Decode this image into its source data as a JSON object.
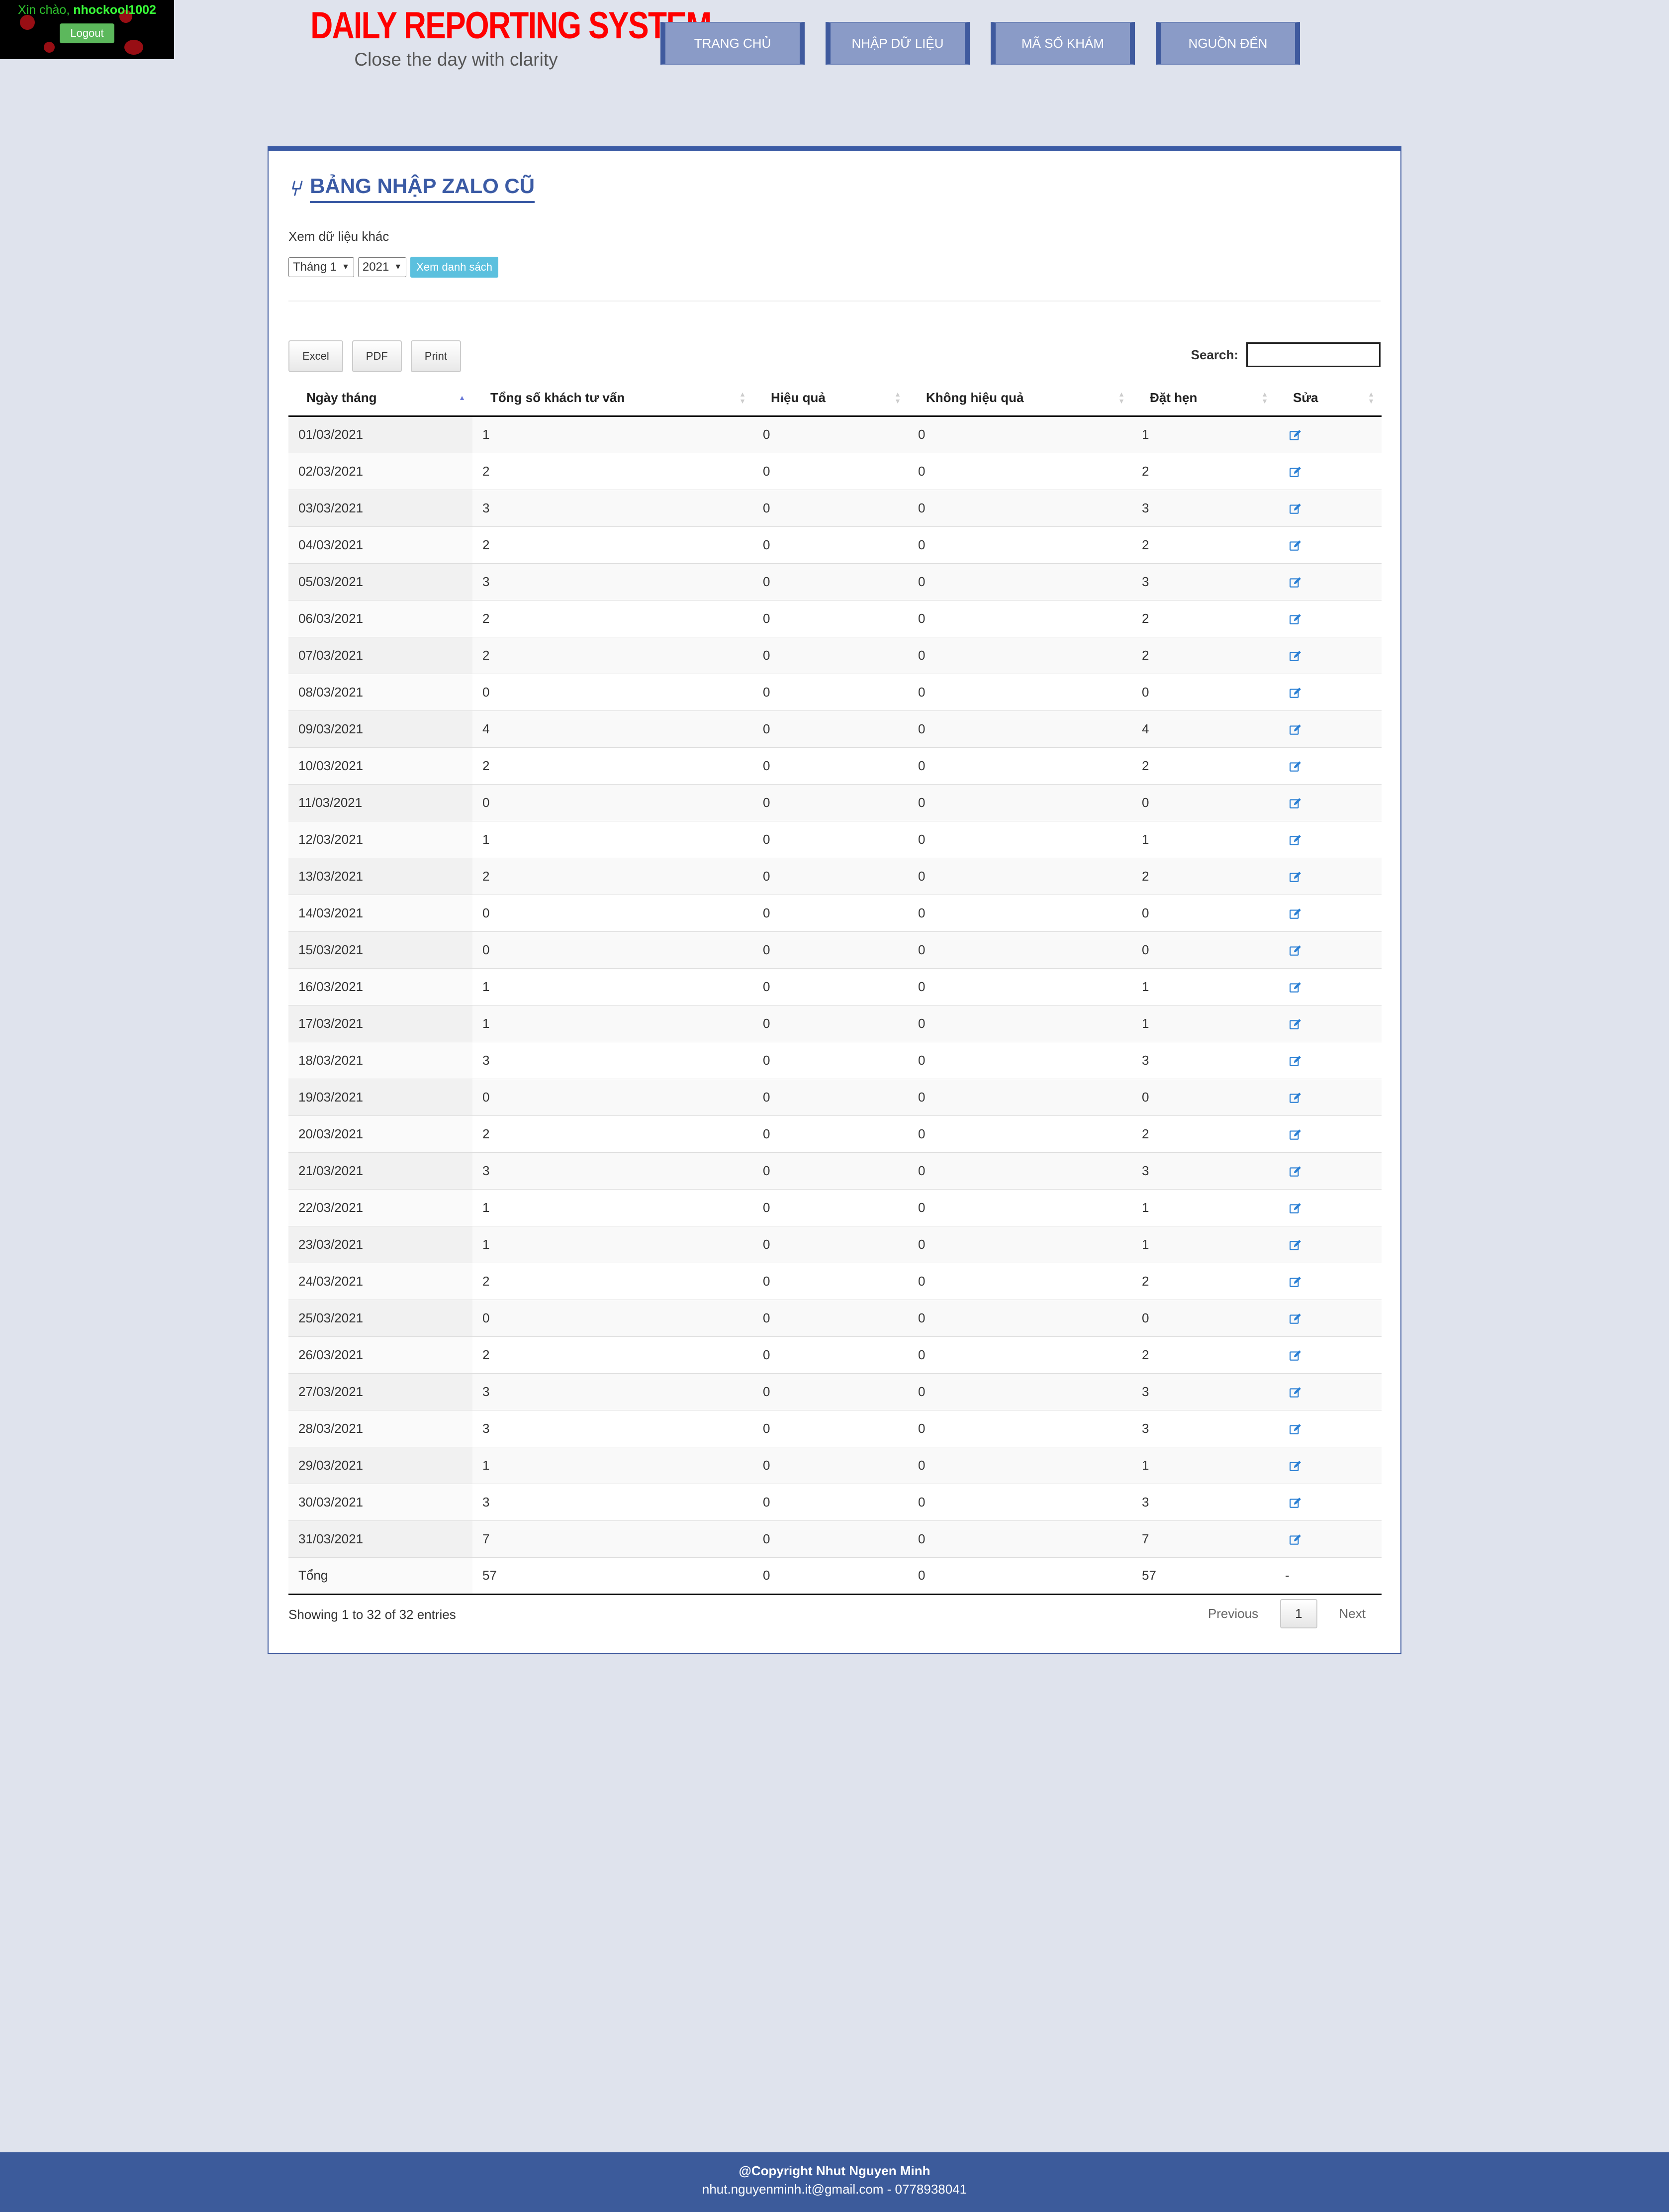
{
  "header": {
    "greeting_prefix": "Xin chào, ",
    "username": "nhockool1002",
    "logout_label": "Logout",
    "brand_title": "DAILY REPORTING SYSTEM",
    "brand_subtitle": "Close the day with clarity",
    "nav": [
      "TRANG CHỦ",
      "NHẬP DỮ LIỆU",
      "MÃ SỐ KHÁM",
      "NGUỒN ĐẾN"
    ]
  },
  "panel": {
    "title": "BẢNG NHẬP ZALO CŨ",
    "filter_label": "Xem dữ liệu khác",
    "month_value": "Tháng 1",
    "year_value": "2021",
    "view_button": "Xem danh sách",
    "tools": [
      "Excel",
      "PDF",
      "Print"
    ],
    "search_label": "Search:"
  },
  "table": {
    "columns": [
      "Ngày tháng",
      "Tổng số khách tư vấn",
      "Hiệu quả",
      "Không hiệu quả",
      "Đặt hẹn",
      "Sửa"
    ],
    "rows": [
      [
        "01/03/2021",
        "1",
        "0",
        "0",
        "1"
      ],
      [
        "02/03/2021",
        "2",
        "0",
        "0",
        "2"
      ],
      [
        "03/03/2021",
        "3",
        "0",
        "0",
        "3"
      ],
      [
        "04/03/2021",
        "2",
        "0",
        "0",
        "2"
      ],
      [
        "05/03/2021",
        "3",
        "0",
        "0",
        "3"
      ],
      [
        "06/03/2021",
        "2",
        "0",
        "0",
        "2"
      ],
      [
        "07/03/2021",
        "2",
        "0",
        "0",
        "2"
      ],
      [
        "08/03/2021",
        "0",
        "0",
        "0",
        "0"
      ],
      [
        "09/03/2021",
        "4",
        "0",
        "0",
        "4"
      ],
      [
        "10/03/2021",
        "2",
        "0",
        "0",
        "2"
      ],
      [
        "11/03/2021",
        "0",
        "0",
        "0",
        "0"
      ],
      [
        "12/03/2021",
        "1",
        "0",
        "0",
        "1"
      ],
      [
        "13/03/2021",
        "2",
        "0",
        "0",
        "2"
      ],
      [
        "14/03/2021",
        "0",
        "0",
        "0",
        "0"
      ],
      [
        "15/03/2021",
        "0",
        "0",
        "0",
        "0"
      ],
      [
        "16/03/2021",
        "1",
        "0",
        "0",
        "1"
      ],
      [
        "17/03/2021",
        "1",
        "0",
        "0",
        "1"
      ],
      [
        "18/03/2021",
        "3",
        "0",
        "0",
        "3"
      ],
      [
        "19/03/2021",
        "0",
        "0",
        "0",
        "0"
      ],
      [
        "20/03/2021",
        "2",
        "0",
        "0",
        "2"
      ],
      [
        "21/03/2021",
        "3",
        "0",
        "0",
        "3"
      ],
      [
        "22/03/2021",
        "1",
        "0",
        "0",
        "1"
      ],
      [
        "23/03/2021",
        "1",
        "0",
        "0",
        "1"
      ],
      [
        "24/03/2021",
        "2",
        "0",
        "0",
        "2"
      ],
      [
        "25/03/2021",
        "0",
        "0",
        "0",
        "0"
      ],
      [
        "26/03/2021",
        "2",
        "0",
        "0",
        "2"
      ],
      [
        "27/03/2021",
        "3",
        "0",
        "0",
        "3"
      ],
      [
        "28/03/2021",
        "3",
        "0",
        "0",
        "3"
      ],
      [
        "29/03/2021",
        "1",
        "0",
        "0",
        "1"
      ],
      [
        "30/03/2021",
        "3",
        "0",
        "0",
        "3"
      ],
      [
        "31/03/2021",
        "7",
        "0",
        "0",
        "7"
      ]
    ],
    "total_row": [
      "Tổng",
      "57",
      "0",
      "0",
      "57",
      "-"
    ],
    "info": "Showing 1 to 32 of 32 entries",
    "prev": "Previous",
    "page": "1",
    "next": "Next"
  },
  "footer": {
    "copyright": "@Copyright Nhut Nguyen Minh",
    "contact": "nhut.nguyenminh.it@gmail.com - 0778938041"
  },
  "colors": {
    "brand_red": "#ff0000",
    "accent_blue": "#3b5ba5",
    "edit_icon": "#2a7fd4"
  }
}
